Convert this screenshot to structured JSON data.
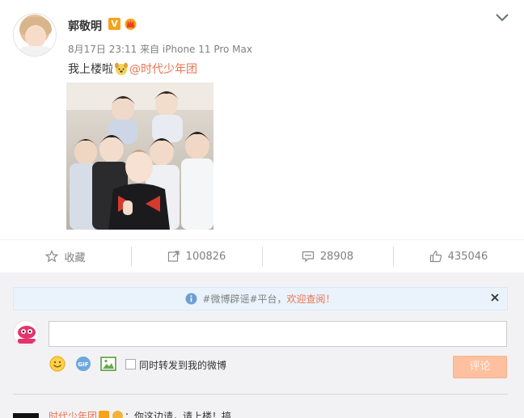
{
  "post": {
    "username": "郭敬明",
    "verified_badge": "V",
    "meta": "8月17日 23:11  来自 iPhone 11 Pro Max",
    "text_before": "我上楼啦",
    "mention": "@时代少年团",
    "icons": [
      "chevron-down-icon",
      "crown-badge-icon",
      "dog-emoji-icon"
    ]
  },
  "actions": {
    "favorite_label": "收藏",
    "repost_count": "100826",
    "comment_count": "28908",
    "like_count": "435046"
  },
  "notice": {
    "text_prefix": "#微博辟谣#平台，",
    "link_text": "欢迎查阅！"
  },
  "comment_box": {
    "input_value": "",
    "sync_label": "同时转发到我的微博",
    "submit_label": "评论"
  },
  "next_comment": {
    "name": "时代少年团",
    "text_fragment": "：你这边请，请上楼！搞"
  },
  "colors": {
    "accent": "#eb7350",
    "badge": "#f7a21b",
    "notice_bg": "#eaf3fc",
    "submit_bg": "#ffc09f",
    "panel_bg": "#f2f2f5"
  }
}
